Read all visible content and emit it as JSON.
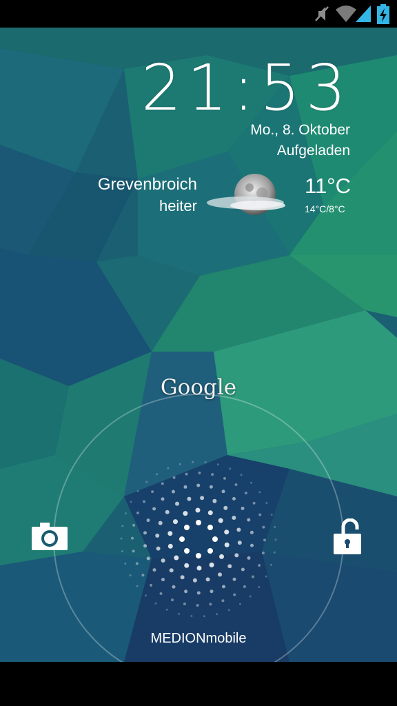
{
  "status_bar": {
    "icons": [
      "mute-icon",
      "wifi-icon",
      "signal-icon",
      "battery-charging-icon"
    ],
    "accent": "#33b5e5"
  },
  "lockscreen": {
    "time": "21:53",
    "date": "Mo., 8. Oktober",
    "charge_status": "Aufgeladen"
  },
  "weather": {
    "location": "Grevenbroich",
    "condition": "heiter",
    "temperature": "11°C",
    "range": "14°C/8°C",
    "icon": "moon-cloud-icon"
  },
  "unlock": {
    "search_label": "Google",
    "left_target_icon": "camera-icon",
    "right_target_icon": "unlock-icon",
    "carrier": "MEDIONmobile"
  },
  "colors": {
    "wallpaper_dark": "#173d60",
    "wallpaper_teal": "#1d8a72",
    "wallpaper_green": "#2e9c7e"
  }
}
